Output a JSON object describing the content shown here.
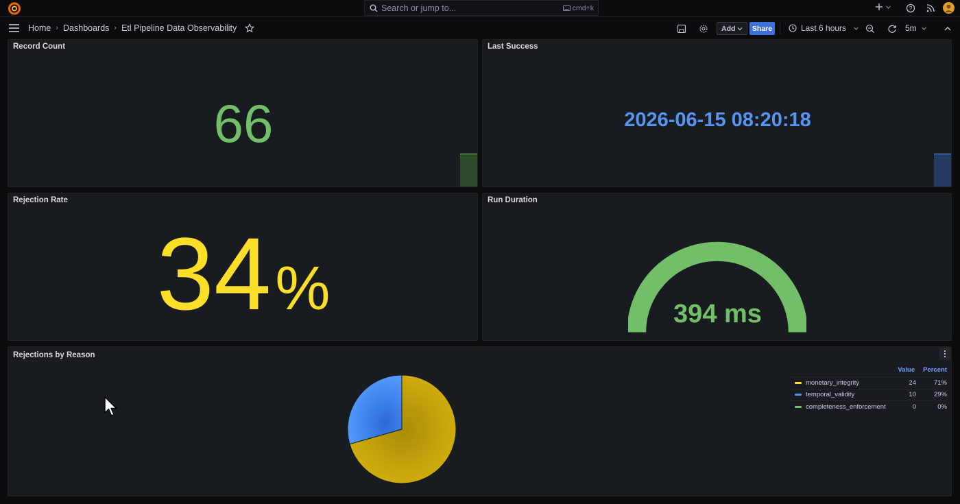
{
  "topbar": {
    "search_placeholder": "Search or jump to...",
    "search_shortcut": "cmd+k"
  },
  "navbar": {
    "breadcrumbs": [
      "Home",
      "Dashboards",
      "Etl Pipeline Data Observability"
    ],
    "add_label": "Add",
    "share_label": "Share",
    "time_range": "Last 6 hours",
    "refresh_interval": "5m"
  },
  "panels": {
    "record_count": {
      "title": "Record Count",
      "value": "66",
      "color": "#73bf69"
    },
    "last_success": {
      "title": "Last Success",
      "value": "2026-06-15 08:20:18",
      "color": "#5794f2"
    },
    "rejection_rate": {
      "title": "Rejection Rate",
      "value": "34",
      "unit": "%",
      "color": "#fade2a"
    },
    "run_duration": {
      "title": "Run Duration",
      "value": "394 ms",
      "color": "#73bf69"
    },
    "rejections_by_reason": {
      "title": "Rejections by Reason",
      "legend_headers": {
        "value": "Value",
        "percent": "Percent"
      }
    }
  },
  "chart_data": {
    "type": "pie",
    "title": "Rejections by Reason",
    "categories": [
      "monetary_integrity",
      "temporal_validity",
      "completeness_enforcement"
    ],
    "values": [
      24,
      10,
      0
    ],
    "percents": [
      "71%",
      "29%",
      "0%"
    ],
    "colors": [
      "#fade2a",
      "#5794f2",
      "#73bf69"
    ],
    "legend_placement": "right"
  }
}
